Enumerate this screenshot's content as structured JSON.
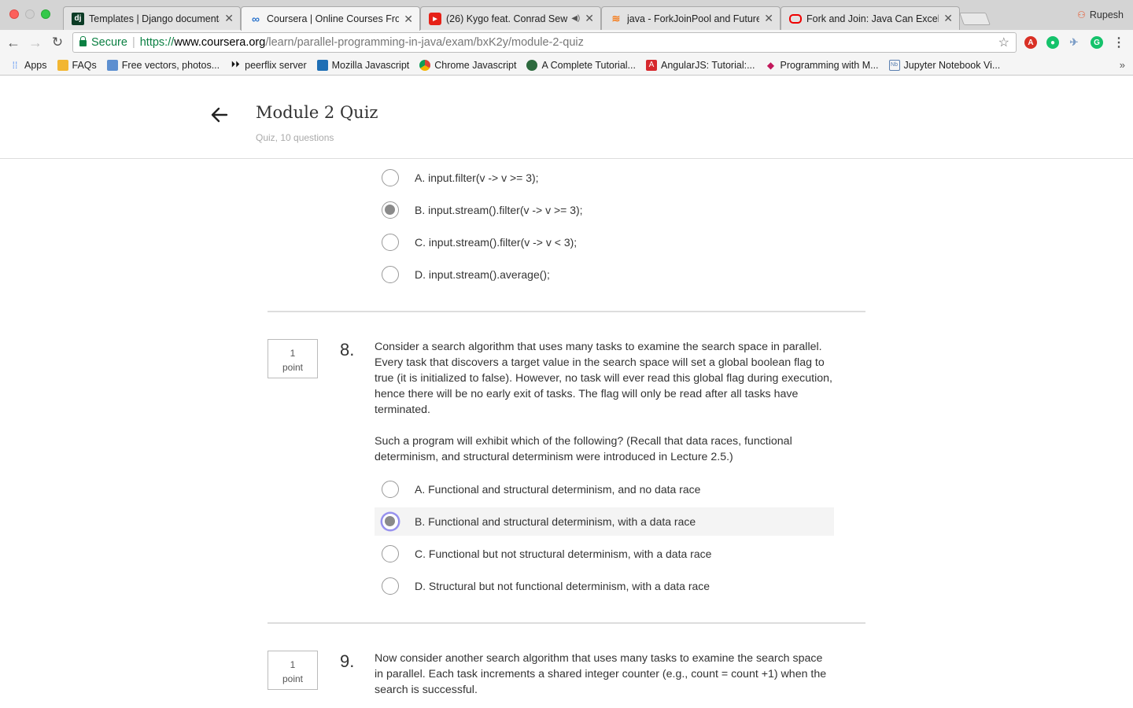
{
  "browser": {
    "tabs": [
      {
        "favicon": "django-icon",
        "title": "Templates | Django documenta",
        "audio": false
      },
      {
        "favicon": "coursera-icon",
        "title": "Coursera | Online Courses Fro",
        "audio": false
      },
      {
        "favicon": "youtube-icon",
        "title": "(26) Kygo feat. Conrad Sew",
        "audio": true
      },
      {
        "favicon": "stackoverflow-icon",
        "title": "java - ForkJoinPool and Future",
        "audio": false
      },
      {
        "favicon": "oracle-icon",
        "title": "Fork and Join: Java Can Excel",
        "audio": false
      }
    ],
    "profile_name": "Rupesh",
    "security_label": "Secure",
    "url_scheme": "https://",
    "url_host": "www.coursera.org",
    "url_path": "/learn/parallel-programming-in-java/exam/bxK2y/module-2-quiz",
    "bookmarks": [
      {
        "icon": "apps-grid-icon",
        "label": "Apps"
      },
      {
        "icon": "folder-icon",
        "label": "FAQs"
      },
      {
        "icon": "freepik-icon",
        "label": "Free vectors, photos..."
      },
      {
        "icon": "peerflix-icon",
        "label": "peerflix server"
      },
      {
        "icon": "mozilla-icon",
        "label": "Mozilla Javascript"
      },
      {
        "icon": "chrome-icon",
        "label": "Chrome Javascript"
      },
      {
        "icon": "tutorial-icon",
        "label": "A Complete Tutorial..."
      },
      {
        "icon": "angular-icon",
        "label": "AngularJS: Tutorial:..."
      },
      {
        "icon": "ruby-icon",
        "label": "Programming with M..."
      },
      {
        "icon": "jupyter-icon",
        "label": "Jupyter Notebook Vi..."
      }
    ],
    "bookmarks_more": "»"
  },
  "header": {
    "title": "Module 2 Quiz",
    "subtitle": "Quiz, 10 questions"
  },
  "q7": {
    "options": [
      {
        "label": "A. input.filter(v -> v >= 3);",
        "selected": false
      },
      {
        "label": "B. input.stream().filter(v -> v >= 3);",
        "selected": true
      },
      {
        "label": "C. input.stream().filter(v -> v < 3);",
        "selected": false
      },
      {
        "label": "D. input.stream().average();",
        "selected": false
      }
    ]
  },
  "q8": {
    "points_value": "1",
    "points_label": "point",
    "number": "8.",
    "paragraph1": "Consider a search algorithm that uses many tasks to examine the search space in parallel. Every task that discovers a target value in the search space will set a global boolean flag to true (it is initialized to false). However, no task will ever read this global flag during execution, hence there will be no early exit of tasks. The flag will only be read after all tasks have terminated.",
    "paragraph2": "Such a program will exhibit which of the following? (Recall that data races, functional determinism, and structural determinism were introduced in Lecture 2.5.)",
    "options": [
      {
        "label": "A. Functional and structural determinism, and no data race",
        "selected": false
      },
      {
        "label": "B. Functional and structural determinism, with a data race",
        "selected": true
      },
      {
        "label": "C. Functional but not structural determinism, with a data race",
        "selected": false
      },
      {
        "label": "D. Structural but not functional determinism, with a data race",
        "selected": false
      }
    ]
  },
  "q9": {
    "points_value": "1",
    "points_label": "point",
    "number": "9.",
    "paragraph1": "Now consider another search algorithm that uses many tasks to examine the search space in parallel. Each task increments a shared integer counter (e.g., count = count +1) when the search is successful."
  }
}
